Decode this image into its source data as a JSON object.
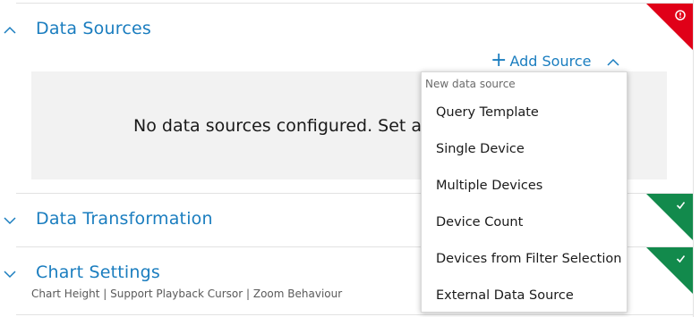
{
  "sections": {
    "data_sources": {
      "title": "Data Sources",
      "status": "error",
      "status_color": "#e00018",
      "status_icon": "error-icon",
      "empty_message": "No data sources configured. Set a",
      "add_source_label": "Add Source"
    },
    "data_transformation": {
      "title": "Data Transformation",
      "status": "ok",
      "status_color": "#128a4c",
      "status_icon": "check-icon"
    },
    "chart_settings": {
      "title": "Chart Settings",
      "subtitle": "Chart Height | Support Playback Cursor | Zoom Behaviour",
      "status": "ok",
      "status_color": "#128a4c",
      "status_icon": "check-icon"
    }
  },
  "dropdown": {
    "header": "New data source",
    "items": [
      "Query Template",
      "Single Device",
      "Multiple Devices",
      "Device Count",
      "Devices from Filter Selection",
      "External Data Source"
    ]
  },
  "colors": {
    "accent": "#1a7dbf",
    "panel": "#f2f2f2"
  }
}
